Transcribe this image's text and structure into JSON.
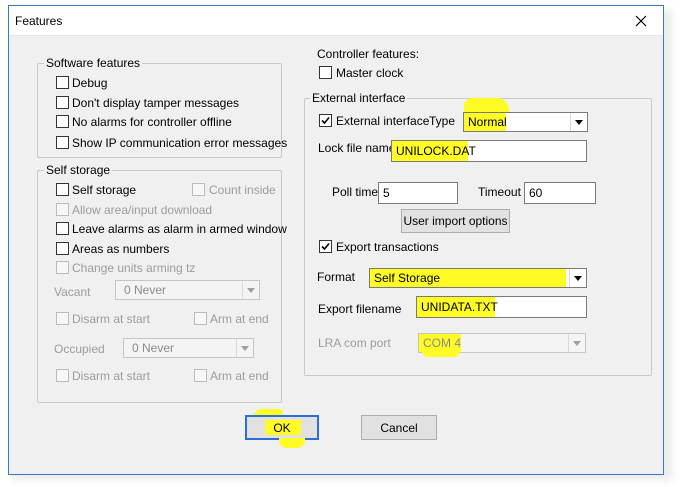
{
  "window": {
    "title": "Features",
    "close_glyph": "close-icon"
  },
  "software_features": {
    "legend": "Software features",
    "items": [
      {
        "label": "Debug",
        "checked": false
      },
      {
        "label": "Don't display tamper messages",
        "checked": false
      },
      {
        "label": "No alarms for controller offline",
        "checked": false
      },
      {
        "label": "Show IP communication error messages",
        "checked": false
      }
    ]
  },
  "self_storage": {
    "legend": "Self storage",
    "self_storage_label": "Self storage",
    "count_inside_label": "Count inside",
    "allow_download_label": "Allow area/input download",
    "leave_alarms_label": "Leave alarms as alarm in armed window",
    "areas_numbers_label": "Areas as numbers",
    "change_units_label": "Change units arming tz",
    "vacant_label": "Vacant",
    "vacant_value": "0 Never",
    "vacant_disarm_label": "Disarm at start",
    "vacant_arm_label": "Arm at end",
    "occupied_label": "Occupied",
    "occupied_value": "0 Never",
    "occupied_disarm_label": "Disarm at start",
    "occupied_arm_label": "Arm at end"
  },
  "controller_features": {
    "label": "Controller features:",
    "master_clock_label": "Master clock",
    "master_clock_checked": false
  },
  "external_interface": {
    "legend": "External interface",
    "enable_label": "External interface",
    "enable_checked": true,
    "type_label": "Type",
    "type_value": "Normal",
    "lock_file_label": "Lock file name",
    "lock_file_value": "UNILOCK.DAT",
    "poll_time_label": "Poll time",
    "poll_time_value": "5",
    "timeout_label": "Timeout",
    "timeout_value": "60",
    "user_import_label": "User import options",
    "export_transactions_label": "Export transactions",
    "export_transactions_checked": true,
    "format_label": "Format",
    "format_value": "Self Storage",
    "export_filename_label": "Export filename",
    "export_filename_value": "UNIDATA.TXT",
    "lra_port_label": "LRA com port",
    "lra_port_value": "COM 4"
  },
  "buttons": {
    "ok": "OK",
    "cancel": "Cancel"
  },
  "colors": {
    "highlight": "#fffb25",
    "window_border": "#3c78c8",
    "default_button_border": "#2b6fd6"
  }
}
